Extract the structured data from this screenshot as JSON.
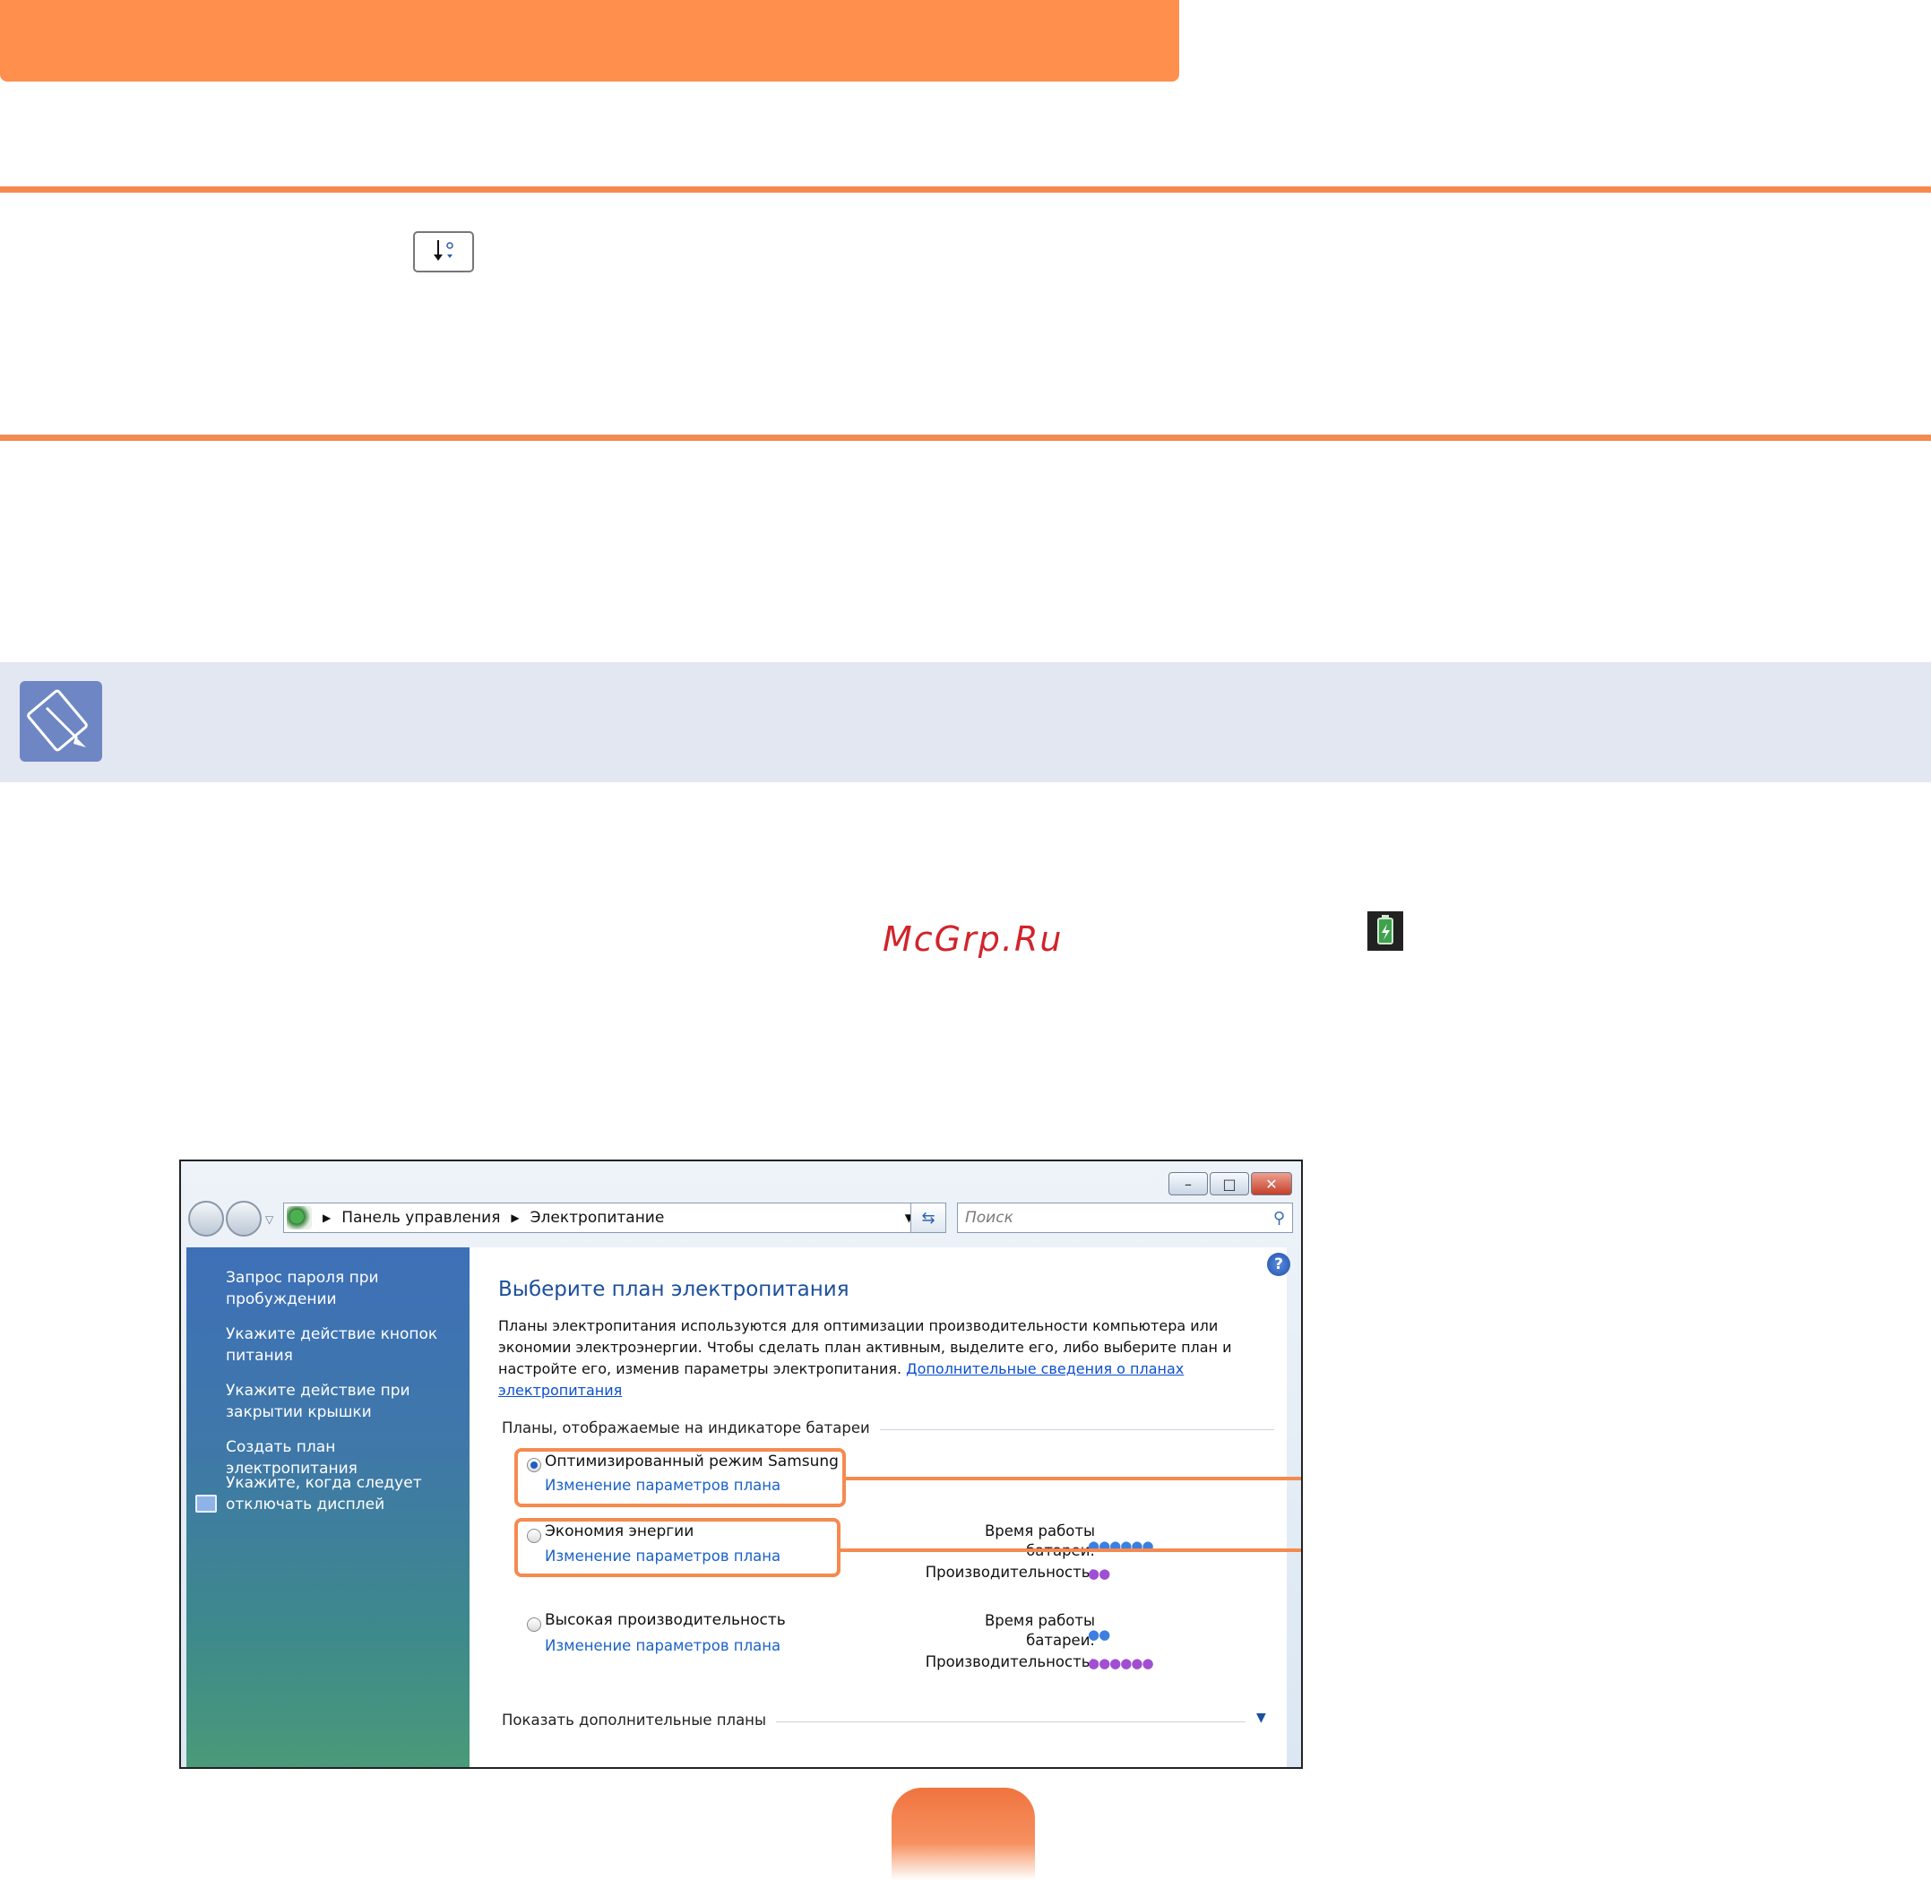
{
  "window": {
    "address": {
      "part1": "Панель управления",
      "part2": "Электропитание"
    },
    "search_placeholder": "Поиск",
    "buttons": {
      "minimize": "–",
      "maximize": "□",
      "close": "✕"
    }
  },
  "sidebar": {
    "items": [
      {
        "label": "Запрос пароля при пробуждении"
      },
      {
        "label": "Укажите действие кнопок питания"
      },
      {
        "label": "Укажите действие при закрытии крышки"
      },
      {
        "label": "Создать план электропитания"
      },
      {
        "label": "Укажите, когда следует отключать дисплей"
      }
    ]
  },
  "content": {
    "title": "Выберите план электропитания",
    "description": "Планы электропитания используются для оптимизации производительности компьютера или экономии электроэнергии. Чтобы сделать план активным, выделите его, либо выберите план и настройте его, изменив параметры электропитания.",
    "description_link": "Дополнительные сведения о планах электропитания",
    "group_label": "Планы, отображаемые на индикаторе батареи",
    "plans": [
      {
        "name": "Оптимизированный режим Samsung",
        "link": "Изменение параметров плана",
        "selected": true
      },
      {
        "name": "Экономия энергии",
        "link": "Изменение параметров плана",
        "selected": false,
        "battery_label": "Время работы батареи:",
        "perf_label": "Производительность:",
        "battery_level": 6,
        "perf_level": 2
      },
      {
        "name": "Высокая производительность",
        "link": "Изменение параметров плана",
        "selected": false,
        "battery_label": "Время работы батареи:",
        "perf_label": "Производительность:",
        "battery_level": 2,
        "perf_level": 6
      }
    ],
    "more_plans": "Показать дополнительные планы"
  },
  "watermark": "McGrp.Ru",
  "icons": {
    "key": "fn-brightness-down-key-icon",
    "note": "pencil-note-icon",
    "tray": "battery-tray-icon",
    "help": "help-icon"
  },
  "colors": {
    "accent": "#f58a4f",
    "note_band": "#e3e7f2",
    "link": "#1a62c8"
  }
}
